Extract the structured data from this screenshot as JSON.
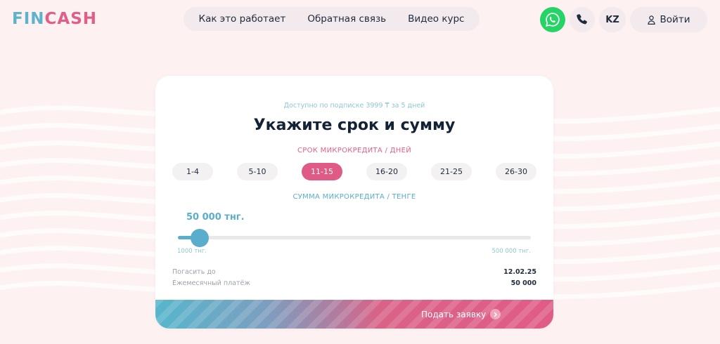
{
  "header": {
    "logo_part1": "FIN",
    "logo_part2": "CASH",
    "nav": [
      "Как это работает",
      "Обратная связь",
      "Видео курс"
    ],
    "lang": "KZ",
    "login_label": "Войти"
  },
  "card": {
    "subtext": "Доступно по подписке 3999 ₸ за 5 дней",
    "heading": "Укажите срок и сумму",
    "term_label": "СРОК МИКРОКРЕДИТА / ДНЕЙ",
    "terms": [
      "1-4",
      "5-10",
      "11-15",
      "16-20",
      "21-25",
      "26-30"
    ],
    "active_term": "11-15",
    "sum_label": "СУММА МИКРОКРЕДИТА / ТЕНГЕ",
    "sum_value": "50 000 тнг.",
    "slider": {
      "min_label": "1000 тнг.",
      "max_label": "500 000 тнг.",
      "min": 1000,
      "max": 500000,
      "value": 50000
    },
    "repay_label": "Погасить до",
    "repay_value": "12.02.25",
    "monthly_label": "Ежемесячный платёж",
    "monthly_value": "50 000",
    "submit_label": "Подать заявку"
  },
  "colors": {
    "brand_blue": "#5aaecb",
    "brand_pink": "#e05a86",
    "whatsapp": "#25d366",
    "background": "#fdf1f2"
  }
}
